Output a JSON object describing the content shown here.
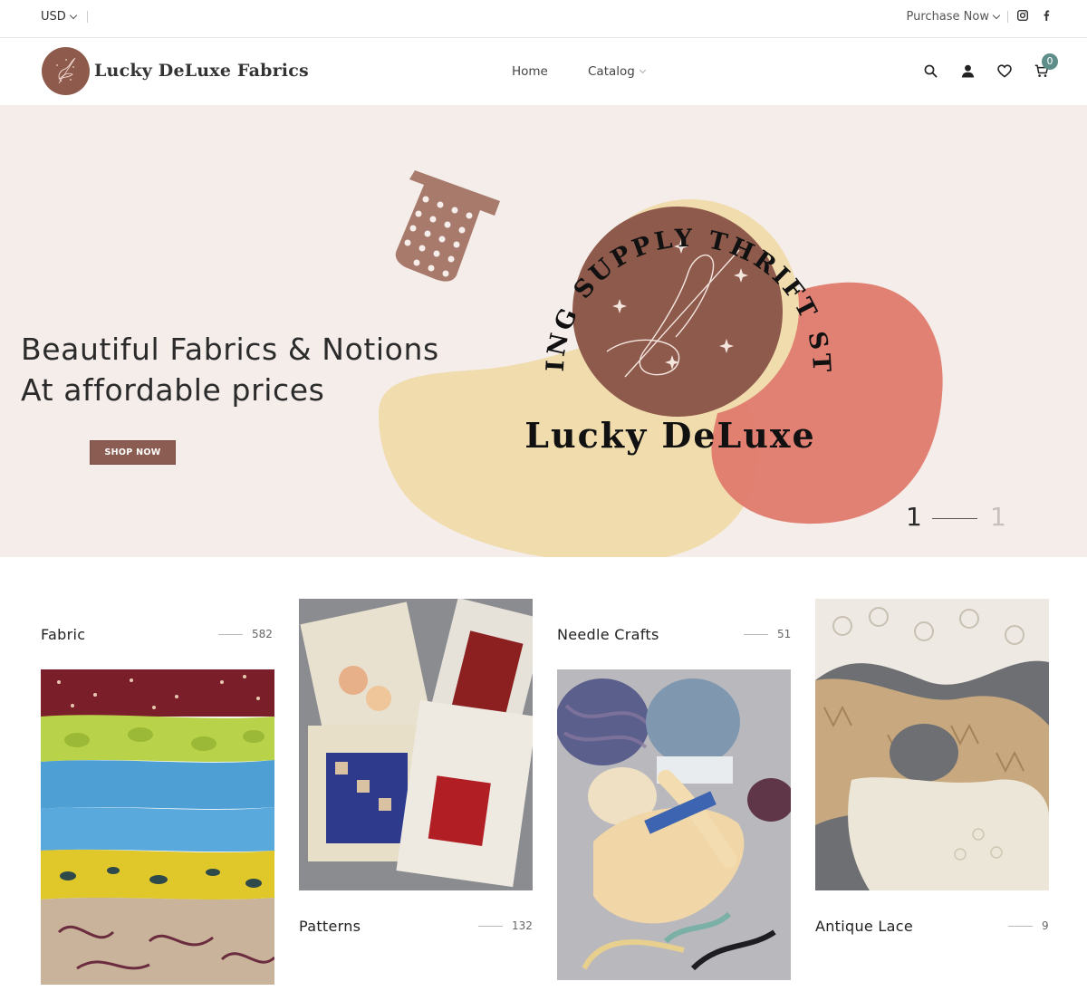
{
  "topbar": {
    "currency": "USD",
    "purchase_label": "Purchase Now",
    "social": [
      "instagram-icon",
      "facebook-icon"
    ]
  },
  "header": {
    "brand": "Lucky DeLuxe Fabrics",
    "nav": [
      {
        "label": "Home"
      },
      {
        "label": "Catalog"
      }
    ],
    "icons": [
      "search-icon",
      "account-icon",
      "wishlist-icon",
      "cart-icon"
    ],
    "cart_count": "0"
  },
  "hero": {
    "title_line1": "Beautiful Fabrics & Notions",
    "title_line2": "At affordable prices",
    "button_label": "SHOP NOW",
    "logo_arc_text": "SEWING SUPPLY THRIFT STORE",
    "logo_name": "Lucky DeLuxe",
    "slide_current": "1",
    "slide_total": "1"
  },
  "categories": [
    {
      "name": "Fabric",
      "count": "582"
    },
    {
      "name": "Patterns",
      "count": "132"
    },
    {
      "name": "Needle Crafts",
      "count": "51"
    },
    {
      "name": "Antique Lace",
      "count": "9"
    }
  ],
  "colors": {
    "brand_brown": "#8e5a4c",
    "hero_bg": "#f5ede9",
    "blob_yellow": "#f0dcad",
    "blob_coral": "#e07c6e",
    "badge_teal": "#5f8d8a"
  }
}
